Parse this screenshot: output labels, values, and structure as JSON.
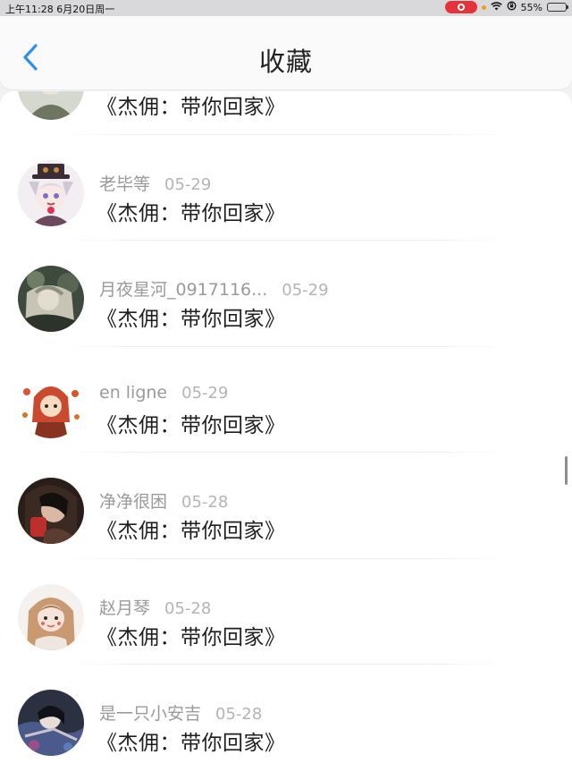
{
  "status_bar": {
    "time_date": "上午11:28  6月20日周一",
    "battery": "55%",
    "battery_level": 0.55
  },
  "nav": {
    "title": "收藏"
  },
  "items": [
    {
      "name": "",
      "date": "",
      "message": "《杰佣：带你回家》"
    },
    {
      "name": "老毕等",
      "date": "05-29",
      "message": "《杰佣：带你回家》"
    },
    {
      "name": "月夜星河_0917116...",
      "date": "05-29",
      "message": "《杰佣：带你回家》"
    },
    {
      "name": "en ligne",
      "date": "05-29",
      "message": "《杰佣：带你回家》"
    },
    {
      "name": "净净很困",
      "date": "05-28",
      "message": "《杰佣：带你回家》"
    },
    {
      "name": "赵月琴",
      "date": "05-28",
      "message": "《杰佣：带你回家》"
    },
    {
      "name": "是一只小安吉",
      "date": "05-28",
      "message": "《杰佣：带你回家》"
    }
  ],
  "colors": {
    "accent": "#2f8ef0",
    "name_text": "#9a9a9a",
    "date_text": "#b4b4b4",
    "message_text": "#1e1e1e"
  }
}
